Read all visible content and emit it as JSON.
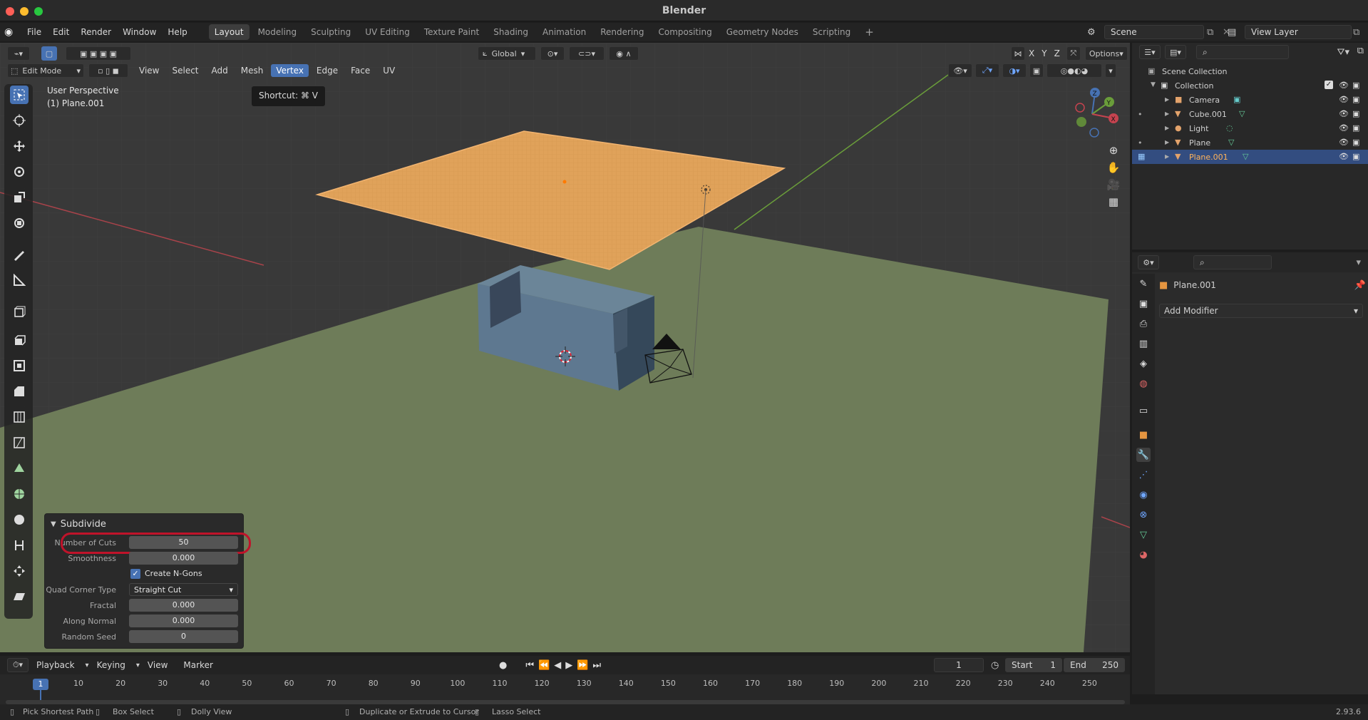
{
  "window": {
    "title": "Blender"
  },
  "menu": [
    "File",
    "Edit",
    "Render",
    "Window",
    "Help"
  ],
  "workspaces": [
    "Layout",
    "Modeling",
    "Sculpting",
    "UV Editing",
    "Texture Paint",
    "Shading",
    "Animation",
    "Rendering",
    "Compositing",
    "Geometry Nodes",
    "Scripting"
  ],
  "active_workspace": "Layout",
  "scene": {
    "name": "Scene"
  },
  "view_layer": {
    "name": "View Layer"
  },
  "viewport_header": {
    "mode": "Edit Mode",
    "menus": [
      "View",
      "Select",
      "Add",
      "Mesh",
      "Vertex",
      "Edge",
      "Face",
      "UV"
    ],
    "active_menu": "Vertex",
    "transform_orientation": "Global",
    "axes": [
      "X",
      "Y",
      "Z"
    ],
    "options_label": "Options"
  },
  "viewport": {
    "perspective_label": "User Perspective",
    "object_label": "(1) Plane.001",
    "tooltip": "Shortcut: ⌘ V",
    "colors": {
      "grid_bg": "#3a3a3a",
      "floor": "#6d7b5a",
      "plane_selected": "#e2a45c",
      "cube": "#5f7b8f"
    }
  },
  "operator_panel": {
    "title": "Subdivide",
    "fields": [
      {
        "label": "Number of Cuts",
        "value": "50"
      },
      {
        "label": "Smoothness",
        "value": "0.000"
      }
    ],
    "checkbox": {
      "label": "Create N-Gons",
      "checked": true
    },
    "quad_corner": {
      "label": "Quad Corner Type",
      "value": "Straight Cut"
    },
    "more_fields": [
      {
        "label": "Fractal",
        "value": "0.000"
      },
      {
        "label": "Along Normal",
        "value": "0.000"
      },
      {
        "label": "Random Seed",
        "value": "0"
      }
    ]
  },
  "outliner": {
    "root": "Scene Collection",
    "collection": "Collection",
    "items": [
      {
        "name": "Camera",
        "icon": "camera-icon"
      },
      {
        "name": "Cube.001",
        "icon": "mesh-icon"
      },
      {
        "name": "Light",
        "icon": "light-icon"
      },
      {
        "name": "Plane",
        "icon": "mesh-icon"
      },
      {
        "name": "Plane.001",
        "icon": "mesh-icon",
        "selected": true
      }
    ]
  },
  "properties": {
    "object_name": "Plane.001",
    "add_modifier": "Add Modifier"
  },
  "timeline": {
    "menus": [
      "Playback",
      "Keying",
      "View",
      "Marker"
    ],
    "current_frame": "1",
    "start_label": "Start",
    "start": "1",
    "end_label": "End",
    "end": "250",
    "ticks": [
      "1",
      "10",
      "20",
      "30",
      "40",
      "50",
      "60",
      "70",
      "80",
      "90",
      "100",
      "110",
      "120",
      "130",
      "140",
      "150",
      "160",
      "170",
      "180",
      "190",
      "200",
      "210",
      "220",
      "230",
      "240",
      "250"
    ]
  },
  "statusbar": {
    "items": [
      "Pick Shortest Path",
      "Box Select",
      "Dolly View",
      "Duplicate or Extrude to Cursor",
      "Lasso Select"
    ],
    "version": "2.93.6"
  }
}
